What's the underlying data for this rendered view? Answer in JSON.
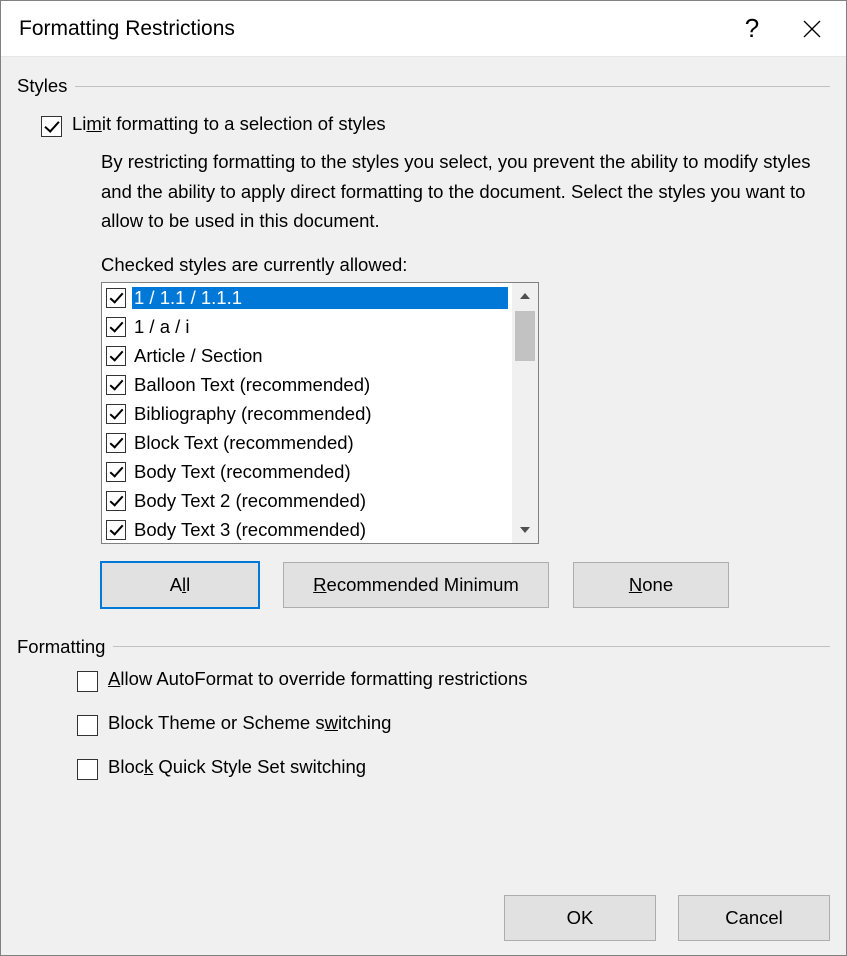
{
  "title": "Formatting Restrictions",
  "styles_group": "Styles",
  "limit_pre": "Li",
  "limit_mn": "m",
  "limit_post": "it formatting to a selection of styles",
  "description": "By restricting formatting to the styles you select, you prevent the ability to modify styles and the ability to apply direct formatting to the document. Select the styles you want to allow to be used in this document.",
  "checked_label": "Checked styles are currently allowed:",
  "styles": [
    {
      "label": "1 / 1.1 / 1.1.1",
      "selected": true
    },
    {
      "label": "1 / a / i",
      "selected": false
    },
    {
      "label": "Article / Section",
      "selected": false
    },
    {
      "label": "Balloon Text (recommended)",
      "selected": false
    },
    {
      "label": "Bibliography (recommended)",
      "selected": false
    },
    {
      "label": "Block Text (recommended)",
      "selected": false
    },
    {
      "label": "Body Text (recommended)",
      "selected": false
    },
    {
      "label": "Body Text 2 (recommended)",
      "selected": false
    },
    {
      "label": "Body Text 3 (recommended)",
      "selected": false
    }
  ],
  "buttons": {
    "all_pre": "A",
    "all_mn": "l",
    "all_post": "l",
    "rec_mn": "R",
    "rec_post": "ecommended Minimum",
    "none_mn": "N",
    "none_post": "one"
  },
  "formatting_group": "Formatting",
  "opt1_mn": "A",
  "opt1_post": "llow AutoFormat to override formatting restrictions",
  "opt2_pre": "Block Theme or Scheme s",
  "opt2_mn": "w",
  "opt2_post": "itching",
  "opt3_pre": "Bloc",
  "opt3_mn": "k",
  "opt3_post": " Quick Style Set switching",
  "ok": "OK",
  "cancel": "Cancel"
}
